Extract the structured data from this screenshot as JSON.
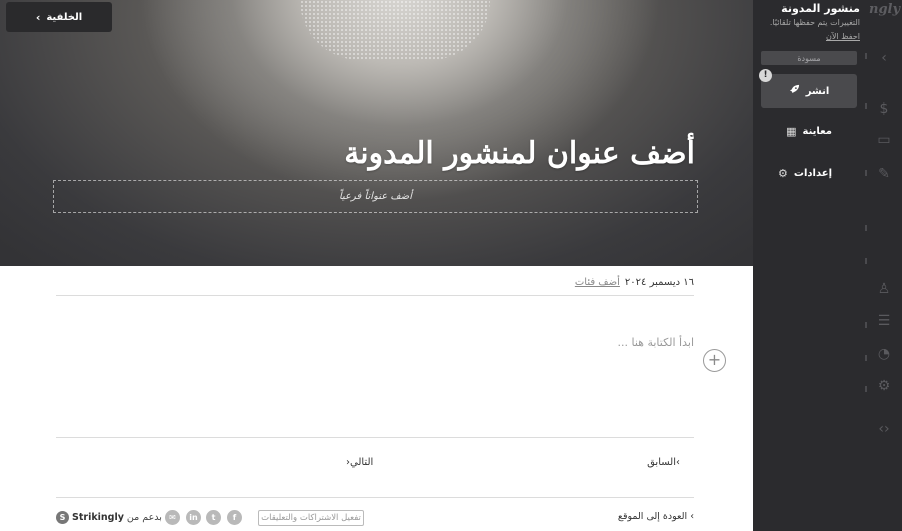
{
  "canvas": {
    "back_label": "الخلفية",
    "post_title": "أضف عنوان لمنشور المدونة",
    "subtitle_placeholder": "أضف عنواناً فرعياً",
    "date": "١٦ ديسمبر ٢٠٢٤",
    "add_categories": "أضف فئات",
    "editor_placeholder": "ابدأ الكتابة هنا ...",
    "prev_label": "السابق",
    "next_label": "التالي",
    "back_to_site": "العودة إلى الموقع",
    "subscriptions_label": "تفعيل الاشتراكات والتعليقات",
    "social_icons": [
      "facebook-icon",
      "twitter-icon",
      "linkedin-icon",
      "email-icon"
    ],
    "powered_prefix": "بدعم من",
    "powered_brand": "Strikingly"
  },
  "panel": {
    "title": "منشور المدونة",
    "autosave_note": "التغييرات يتم حفظها تلقائيًا.",
    "save_now": "احفظ الآن",
    "draft_badge": "مسودة",
    "publish_label": "انشر",
    "preview_label": "معاينة",
    "settings_label": "إعدادات"
  },
  "rail": {
    "logo": "ngly"
  },
  "colors": {
    "panel_bg": "#2b2b2e",
    "button_bg": "#4a4a4d",
    "canvas_bg": "#ffffff"
  }
}
